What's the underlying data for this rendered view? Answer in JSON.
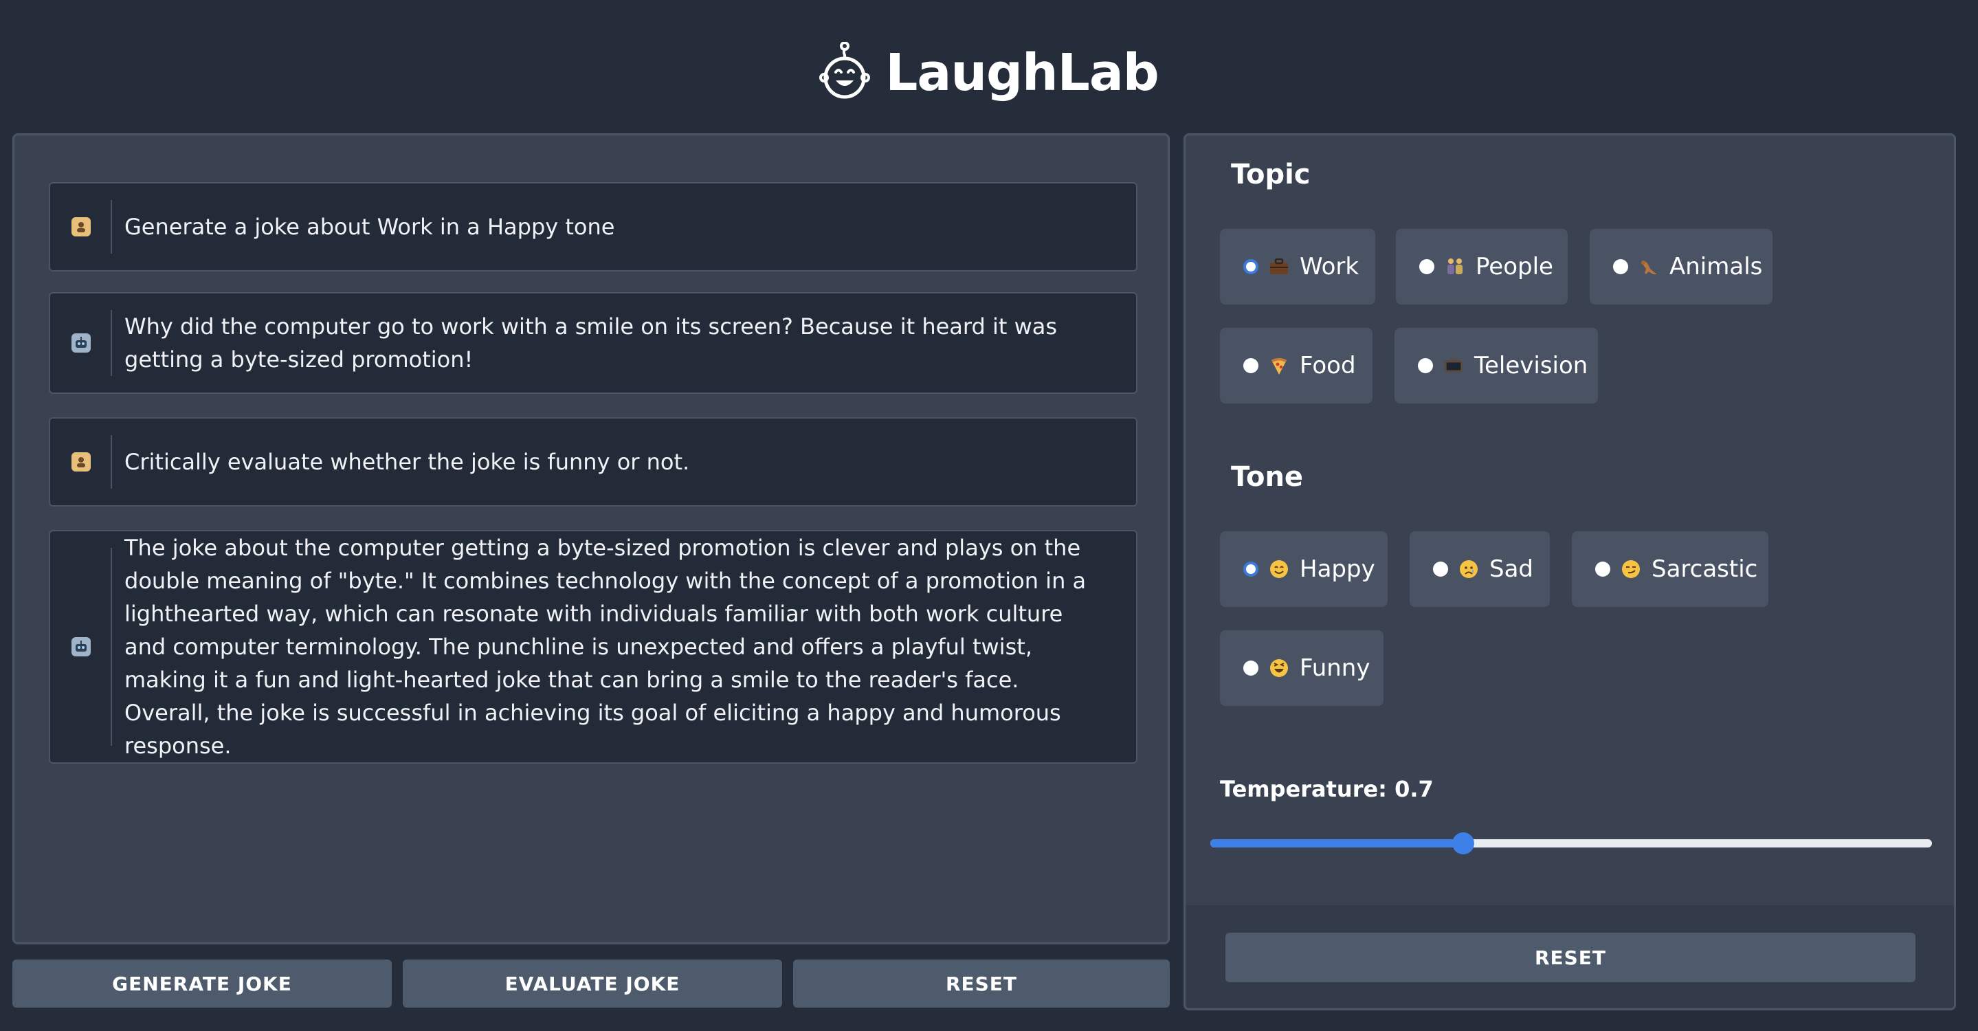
{
  "app": {
    "title": "LaughLab",
    "logo_icon": "laughing-baby-face-icon"
  },
  "chat": {
    "messages": [
      {
        "role": "user",
        "icon": "user-avatar-icon",
        "text": "Generate a joke about Work in a Happy tone"
      },
      {
        "role": "assistant",
        "icon": "robot-avatar-icon",
        "text": "Why did the computer go to work with a smile on its screen? Because it heard it was getting a byte-sized promotion!"
      },
      {
        "role": "user",
        "icon": "user-avatar-icon",
        "text": "Critically evaluate whether the joke is funny or not."
      },
      {
        "role": "assistant",
        "icon": "robot-avatar-icon",
        "text": "The joke about the computer getting a byte-sized promotion is clever and plays on the double meaning of \"byte.\" It combines technology with the concept of a promotion in a lighthearted way, which can resonate with individuals familiar with both work culture and computer terminology. The punchline is unexpected and offers a playful twist, making it a fun and light-hearted joke that can bring a smile to the reader's face. Overall, the joke is successful in achieving its goal of eliciting a happy and humorous response."
      }
    ]
  },
  "actions": {
    "generate_label": "GENERATE JOKE",
    "evaluate_label": "EVALUATE JOKE",
    "reset_label": "RESET"
  },
  "settings": {
    "topic": {
      "title": "Topic",
      "selected": "Work",
      "options": [
        {
          "label": "Work",
          "icon": "briefcase-icon"
        },
        {
          "label": "People",
          "icon": "people-icon"
        },
        {
          "label": "Animals",
          "icon": "kangaroo-icon"
        },
        {
          "label": "Food",
          "icon": "pizza-icon"
        },
        {
          "label": "Television",
          "icon": "television-icon"
        }
      ]
    },
    "tone": {
      "title": "Tone",
      "selected": "Happy",
      "options": [
        {
          "label": "Happy",
          "icon": "smiling-face-icon"
        },
        {
          "label": "Sad",
          "icon": "sad-face-icon"
        },
        {
          "label": "Sarcastic",
          "icon": "smirking-face-icon"
        },
        {
          "label": "Funny",
          "icon": "laughing-face-icon"
        }
      ]
    },
    "temperature": {
      "label": "Temperature: 0.7",
      "value": 0.7,
      "min": 0,
      "max": 2
    },
    "reset_label": "RESET"
  },
  "colors": {
    "background": "#252c3a",
    "panel": "#3a4252",
    "accent": "#3e7fe8",
    "button": "#4e5b6c"
  }
}
